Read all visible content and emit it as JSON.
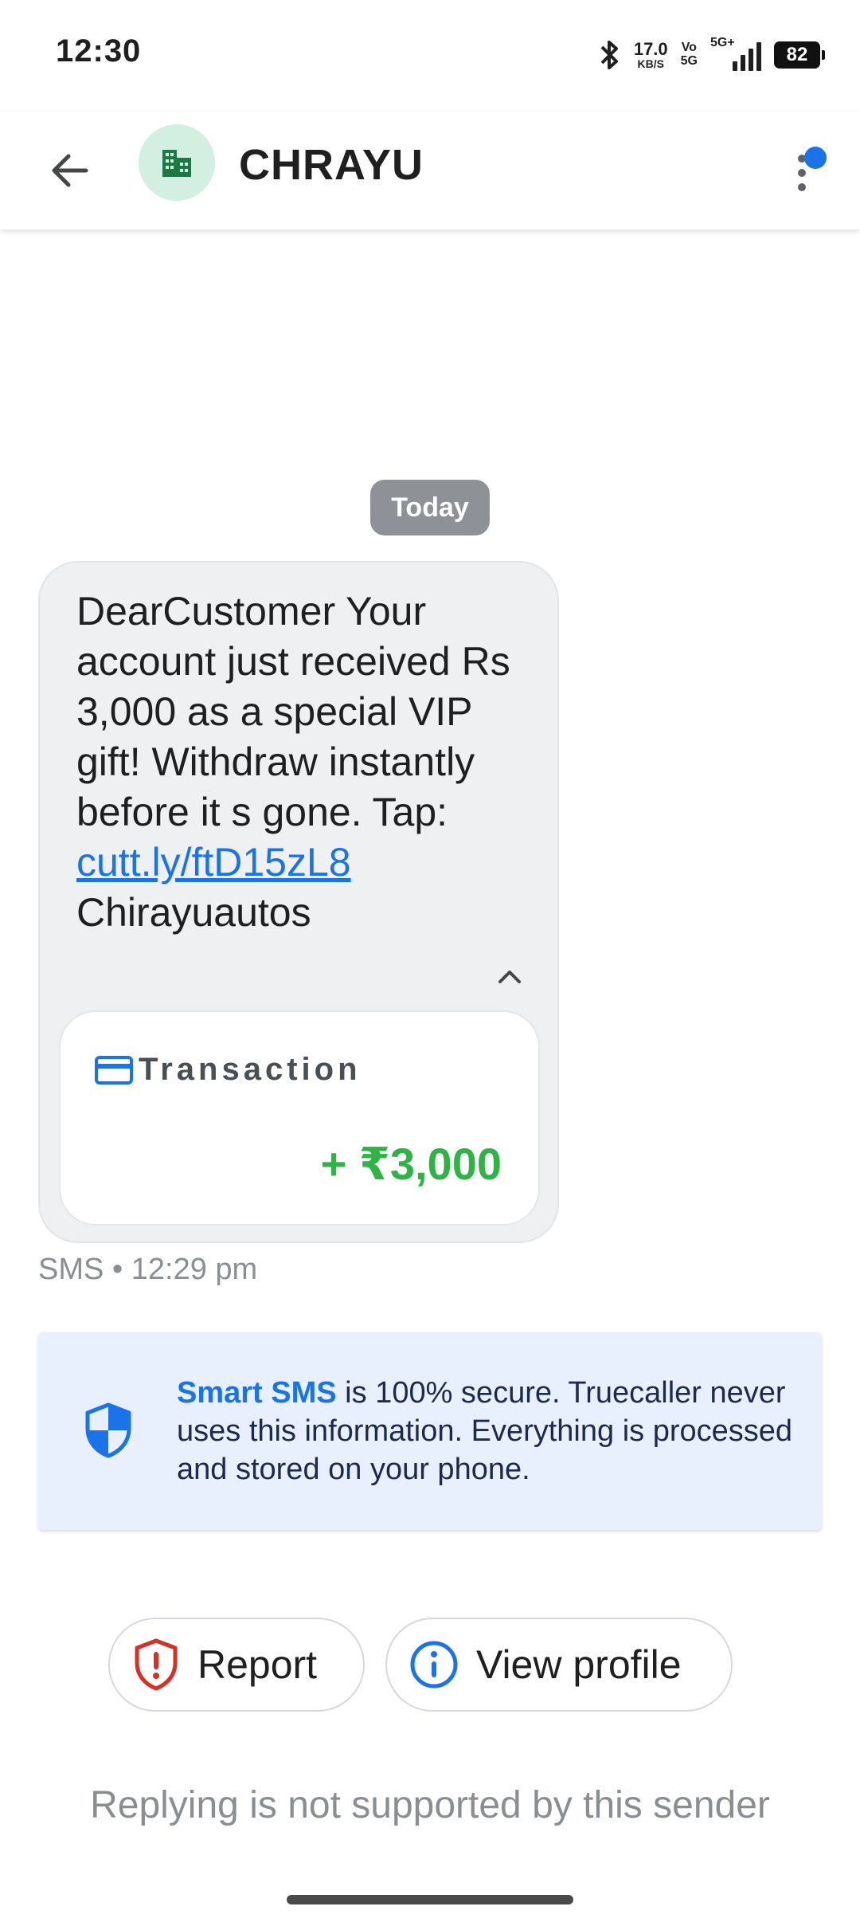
{
  "status_bar": {
    "time": "12:30",
    "net_speed_value": "17.0",
    "net_speed_unit": "KB/S",
    "volte_top": "Vo",
    "volte_bottom": "5G",
    "network_type": "5G+",
    "battery": "82",
    "icons": [
      "bluetooth-icon",
      "signal-icon",
      "battery-icon"
    ]
  },
  "header": {
    "contact_name": "CHRAYU",
    "avatar_icon": "business-building-icon",
    "avatar_color": "#d3efe1",
    "notification_dot_color": "#1a73e8"
  },
  "conversation": {
    "date_label": "Today",
    "message": {
      "body": "DearCustomer Your account just received Rs 3,000 as a special VIP gift! Withdraw instantly before it s gone. Tap: ",
      "link": "cutt.ly/ftD15zL8",
      "signature": "Chirayuautos",
      "meta": "SMS • 12:29 pm"
    },
    "transaction_card": {
      "title": "Transaction",
      "amount": "+ ₹3,000",
      "amount_color": "#2fb344"
    }
  },
  "info_banner": {
    "highlight": "Smart SMS",
    "text": " is 100% secure. Truecaller never uses this information. Everything is processed and stored on your phone."
  },
  "actions": {
    "report_label": "Report",
    "view_profile_label": "View profile"
  },
  "footer": {
    "reply_note": "Replying is not supported by this sender"
  }
}
